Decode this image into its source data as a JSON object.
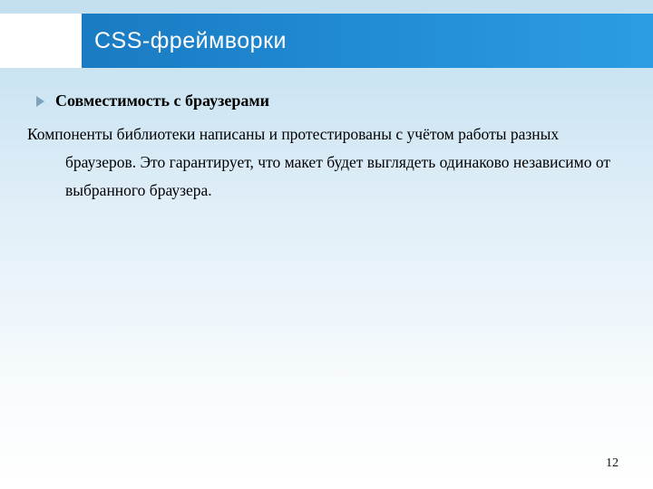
{
  "header": {
    "title": "CSS-фреймворки"
  },
  "content": {
    "bullet": "Совместимость с браузерами",
    "paragraph": "Компоненты библиотеки написаны и протестированы с учётом работы разных браузеров. Это гарантирует, что макет будет выглядеть одинаково независимо от выбранного браузера."
  },
  "footer": {
    "page_number": "12"
  }
}
